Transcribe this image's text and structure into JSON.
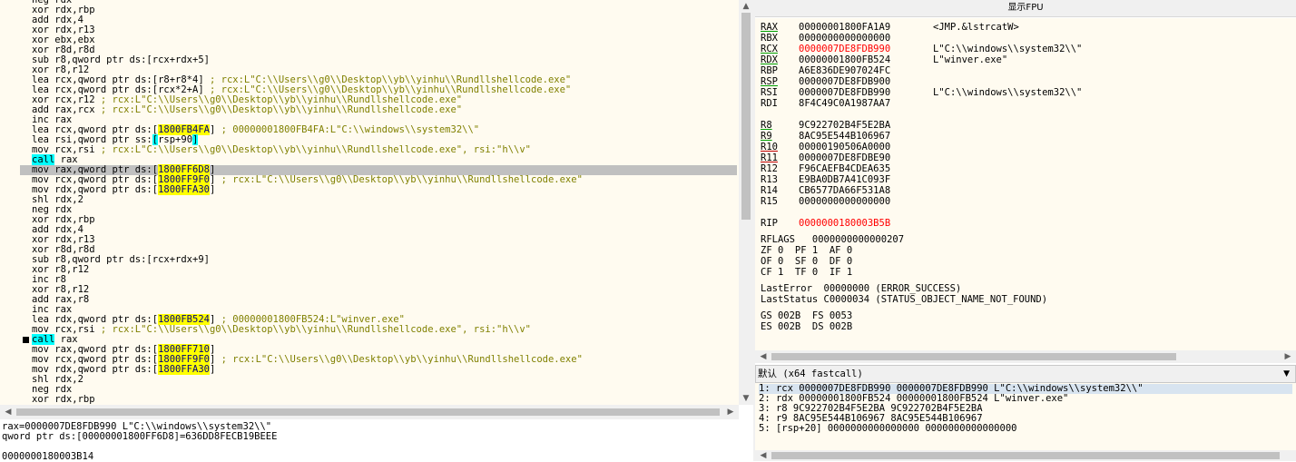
{
  "disasm": {
    "lines": [
      [
        {
          "t": "neg rdx"
        }
      ],
      [
        {
          "t": "xor rdx,rbp"
        }
      ],
      [
        {
          "t": "add rdx,4"
        }
      ],
      [
        {
          "t": "xor rdx,r13"
        }
      ],
      [
        {
          "t": "xor ebx,ebx"
        }
      ],
      [
        {
          "t": "xor r8d,r8d"
        }
      ],
      [
        {
          "t": "sub r8,qword ptr ds:[rcx+rdx+5]"
        }
      ],
      [
        {
          "t": "xor r8,r12"
        }
      ],
      [
        {
          "t": "lea rcx,qword ptr ds:[r8+r8*4]"
        },
        {
          "t": " ; rcx:L\"C:\\\\Users\\\\g0\\\\Desktop\\\\yb\\\\yinhu\\\\Rundllshellcode.exe\"",
          "c": "cmt"
        }
      ],
      [
        {
          "t": "lea rcx,qword ptr ds:[rcx*2+A]"
        },
        {
          "t": " ; rcx:L\"C:\\\\Users\\\\g0\\\\Desktop\\\\yb\\\\yinhu\\\\Rundllshellcode.exe\"",
          "c": "cmt"
        }
      ],
      [
        {
          "t": "xor rcx,r12"
        },
        {
          "t": " ; rcx:L\"C:\\\\Users\\\\g0\\\\Desktop\\\\yb\\\\yinhu\\\\Rundllshellcode.exe\"",
          "c": "cmt"
        }
      ],
      [
        {
          "t": "add rax,rcx"
        },
        {
          "t": " ; rcx:L\"C:\\\\Users\\\\g0\\\\Desktop\\\\yb\\\\yinhu\\\\Rundllshellcode.exe\"",
          "c": "cmt"
        }
      ],
      [
        {
          "t": "inc rax"
        }
      ],
      [
        {
          "t": "lea rcx,qword ptr ds:["
        },
        {
          "t": "1800FB4FA",
          "c": "hl"
        },
        {
          "t": "]"
        },
        {
          "t": " ; 00000001800FB4FA:L\"C:\\\\windows\\\\system32\\\\\"",
          "c": "cmt"
        }
      ],
      [
        {
          "t": "lea rsi,qword ptr ss:"
        },
        {
          "t": "[",
          "c": "cyanhl"
        },
        {
          "t": "rsp+90"
        },
        {
          "t": "]",
          "c": "cyanhl"
        }
      ],
      [
        {
          "t": "mov rcx,rsi"
        },
        {
          "t": " ; rcx:L\"C:\\\\Users\\\\g0\\\\Desktop\\\\yb\\\\yinhu\\\\Rundllshellcode.exe\", rsi:\"h\\\\v\"",
          "c": "cmt"
        }
      ],
      [
        {
          "t": "call",
          "c": "callhl"
        },
        {
          "t": " rax"
        }
      ],
      [
        {
          "t": "mov rax,qword ptr ds:["
        },
        {
          "t": "1800FF6D8",
          "c": "hl"
        },
        {
          "t": "]"
        }
      ],
      [
        {
          "t": "mov rcx,qword ptr ds:["
        },
        {
          "t": "1800FF9F0",
          "c": "hl"
        },
        {
          "t": "]"
        },
        {
          "t": " ; rcx:L\"C:\\\\Users\\\\g0\\\\Desktop\\\\yb\\\\yinhu\\\\Rundllshellcode.exe\"",
          "c": "cmt"
        }
      ],
      [
        {
          "t": "mov rdx,qword ptr ds:["
        },
        {
          "t": "1800FFA30",
          "c": "hl"
        },
        {
          "t": "]"
        }
      ],
      [
        {
          "t": "shl rdx,2"
        }
      ],
      [
        {
          "t": "neg rdx"
        }
      ],
      [
        {
          "t": "xor rdx,rbp"
        }
      ],
      [
        {
          "t": "add rdx,4"
        }
      ],
      [
        {
          "t": "xor rdx,r13"
        }
      ],
      [
        {
          "t": "xor r8d,r8d"
        }
      ],
      [
        {
          "t": "sub r8,qword ptr ds:[rcx+rdx+9]"
        }
      ],
      [
        {
          "t": "xor r8,r12"
        }
      ],
      [
        {
          "t": "inc r8"
        }
      ],
      [
        {
          "t": "xor r8,r12"
        }
      ],
      [
        {
          "t": "add rax,r8"
        }
      ],
      [
        {
          "t": "inc rax"
        }
      ],
      [
        {
          "t": "lea rdx,qword ptr ds:["
        },
        {
          "t": "1800FB524",
          "c": "hl"
        },
        {
          "t": "]"
        },
        {
          "t": " ; 00000001800FB524:L\"winver.exe\"",
          "c": "cmt"
        }
      ],
      [
        {
          "t": "mov rcx,rsi"
        },
        {
          "t": " ; rcx:L\"C:\\\\Users\\\\g0\\\\Desktop\\\\yb\\\\yinhu\\\\Rundllshellcode.exe\", rsi:\"h\\\\v\"",
          "c": "cmt"
        }
      ],
      [
        {
          "t": "call",
          "c": "callhl"
        },
        {
          "t": " rax"
        }
      ],
      [
        {
          "t": "mov rax,qword ptr ds:["
        },
        {
          "t": "1800FF710",
          "c": "hl"
        },
        {
          "t": "]"
        }
      ],
      [
        {
          "t": "mov rcx,qword ptr ds:["
        },
        {
          "t": "1800FF9F0",
          "c": "hl"
        },
        {
          "t": "]"
        },
        {
          "t": " ; rcx:L\"C:\\\\Users\\\\g0\\\\Desktop\\\\yb\\\\yinhu\\\\Rundllshellcode.exe\"",
          "c": "cmt"
        }
      ],
      [
        {
          "t": "mov rdx,qword ptr ds:["
        },
        {
          "t": "1800FFA30",
          "c": "hl"
        },
        {
          "t": "]"
        }
      ],
      [
        {
          "t": "shl rdx,2"
        }
      ],
      [
        {
          "t": "neg rdx"
        }
      ],
      [
        {
          "t": "xor rdx,rbp"
        }
      ]
    ],
    "selected_index": 17,
    "breakpoint_index": 34
  },
  "info": {
    "line1": "rax=0000007DE8FDB990 L\"C:\\\\windows\\\\system32\\\\\"",
    "line2": "qword ptr ds:[00000001800FF6D8]=636DD8FECB19BEEE",
    "line3": "",
    "line4": "0000000180003B14"
  },
  "fpu": {
    "title": "显示FPU",
    "registers": [
      {
        "name": "RAX",
        "value": "00000001800FA1A9",
        "comment": "<JMP.&lstrcatW>",
        "ul": "g"
      },
      {
        "name": "RBX",
        "value": "0000000000000000",
        "comment": ""
      },
      {
        "name": "RCX",
        "value": "0000007DE8FDB990",
        "comment": "L\"C:\\\\windows\\\\system32\\\\\"",
        "ul": "g",
        "red": true
      },
      {
        "name": "RDX",
        "value": "00000001800FB524",
        "comment": "L\"winver.exe\"",
        "ul": "g"
      },
      {
        "name": "RBP",
        "value": "A6E836DE907024FC",
        "comment": ""
      },
      {
        "name": "RSP",
        "value": "0000007DE8FDB900",
        "comment": "",
        "ul": "g"
      },
      {
        "name": "RSI",
        "value": "0000007DE8FDB990",
        "comment": "L\"C:\\\\windows\\\\system32\\\\\""
      },
      {
        "name": "RDI",
        "value": "8F4C49C0A1987AA7",
        "comment": ""
      },
      {
        "name": "",
        "value": "",
        "comment": ""
      },
      {
        "name": "R8",
        "value": "9C922702B4F5E2BA",
        "comment": "",
        "ul": "g"
      },
      {
        "name": "R9",
        "value": "8AC95E544B106967",
        "comment": "",
        "ul": "g"
      },
      {
        "name": "R10",
        "value": "00000190506A0000",
        "comment": "",
        "ul": "r"
      },
      {
        "name": "R11",
        "value": "0000007DE8FDBE90",
        "comment": "",
        "ul": "r"
      },
      {
        "name": "R12",
        "value": "F96CAEFB4CDEA635",
        "comment": ""
      },
      {
        "name": "R13",
        "value": "E9BA0DB7A41C093F",
        "comment": ""
      },
      {
        "name": "R14",
        "value": "CB6577DA66F531A8",
        "comment": ""
      },
      {
        "name": "R15",
        "value": "0000000000000000",
        "comment": ""
      },
      {
        "name": "",
        "value": "",
        "comment": ""
      },
      {
        "name": "RIP",
        "value": "0000000180003B5B",
        "comment": "",
        "red": true
      }
    ],
    "rflags": "RFLAGS   0000000000000207",
    "flags": [
      "ZF 0  PF 1  AF 0",
      "OF 0  SF 0  DF 0",
      "CF 1  TF 0  IF 1"
    ],
    "last_error": "LastError  00000000 (ERROR_SUCCESS)",
    "last_status": "LastStatus C0000034 (STATUS_OBJECT_NAME_NOT_FOUND)",
    "segs": [
      "GS 002B  FS 0053",
      "ES 002B  DS 002B"
    ]
  },
  "callconv": {
    "label": "默认 (x64 fastcall)",
    "arrow": "▼"
  },
  "stack": {
    "lines": [
      "1: rcx 0000007DE8FDB990 0000007DE8FDB990 L\"C:\\\\windows\\\\system32\\\\\"",
      "2: rdx 00000001800FB524 00000001800FB524 L\"winver.exe\"",
      "3: r8 9C922702B4F5E2BA 9C922702B4F5E2BA",
      "4: r9 8AC95E544B106967 8AC95E544B106967",
      "5: [rsp+20] 0000000000000000 0000000000000000"
    ]
  },
  "arrows": {
    "up": "▲",
    "down": "▼",
    "left": "◀",
    "right": "▶"
  }
}
